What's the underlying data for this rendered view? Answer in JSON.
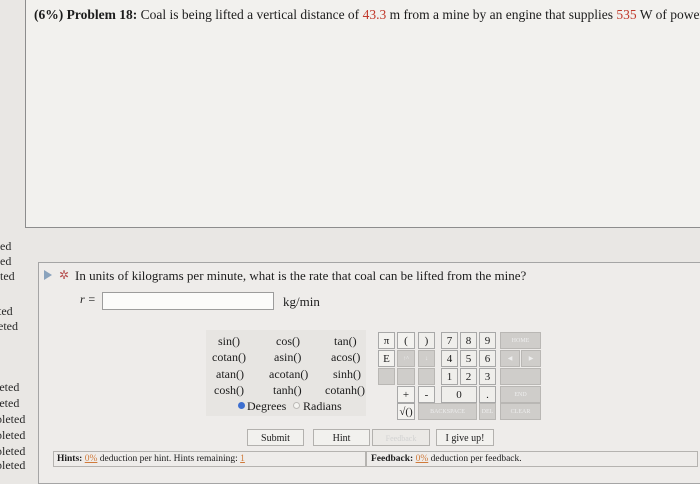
{
  "problem": {
    "weight": "(6%)",
    "label": "Problem 18:",
    "text_before": "Coal is being lifted a vertical distance of",
    "distance": "43.3",
    "text_mid": "m from a mine by an engine that supplies",
    "power": "535",
    "text_after": "W of power."
  },
  "sidebar": {
    "fragments": [
      "ed",
      "ed",
      "ted",
      "ted",
      "eted",
      "leted",
      "leted",
      "pleted",
      "pleted",
      "pleted",
      "pleted",
      "pleted"
    ]
  },
  "question": {
    "text": "In units of kilograms per minute, what is the rate that coal can be lifted from the mine?",
    "variable_label": "r =",
    "answer_value": "",
    "units": "kg/min"
  },
  "calculator": {
    "functions": [
      [
        "sin()",
        "cos()",
        "tan()"
      ],
      [
        "cotan()",
        "asin()",
        "acos()"
      ],
      [
        "atan()",
        "acotan()",
        "sinh()"
      ],
      [
        "cosh()",
        "tanh()",
        "cotanh()"
      ]
    ],
    "angle_mode": {
      "degrees": "Degrees",
      "radians": "Radians"
    },
    "keys": {
      "pi": "π",
      "open_paren": "(",
      "close_paren": ")",
      "e": "E",
      "up": "↑^",
      "down": "↓",
      "seven": "7",
      "eight": "8",
      "nine": "9",
      "four": "4",
      "five": "5",
      "six": "6",
      "one": "1",
      "two": "2",
      "three": "3",
      "plus": "+",
      "minus": "-",
      "zero": "0",
      "dot": ".",
      "sqrt": "√()",
      "backspace": "BACKSPACE",
      "del": "DEL",
      "home": "HOME",
      "end": "END",
      "clear": "CLEAR"
    }
  },
  "buttons": {
    "submit": "Submit",
    "hint": "Hint",
    "feedback": "Feedback",
    "give_up": "I give up!"
  },
  "hints": {
    "label": "Hints:",
    "percent": "0%",
    "text": "deduction per hint. Hints remaining:",
    "remaining": "1"
  },
  "feedback": {
    "label": "Feedback:",
    "percent": "0%",
    "text": "deduction per feedback."
  },
  "colors": {
    "value_highlight": "#c0392b",
    "radio_selected": "#3d6fd0",
    "link_orange": "#d07a3a"
  }
}
